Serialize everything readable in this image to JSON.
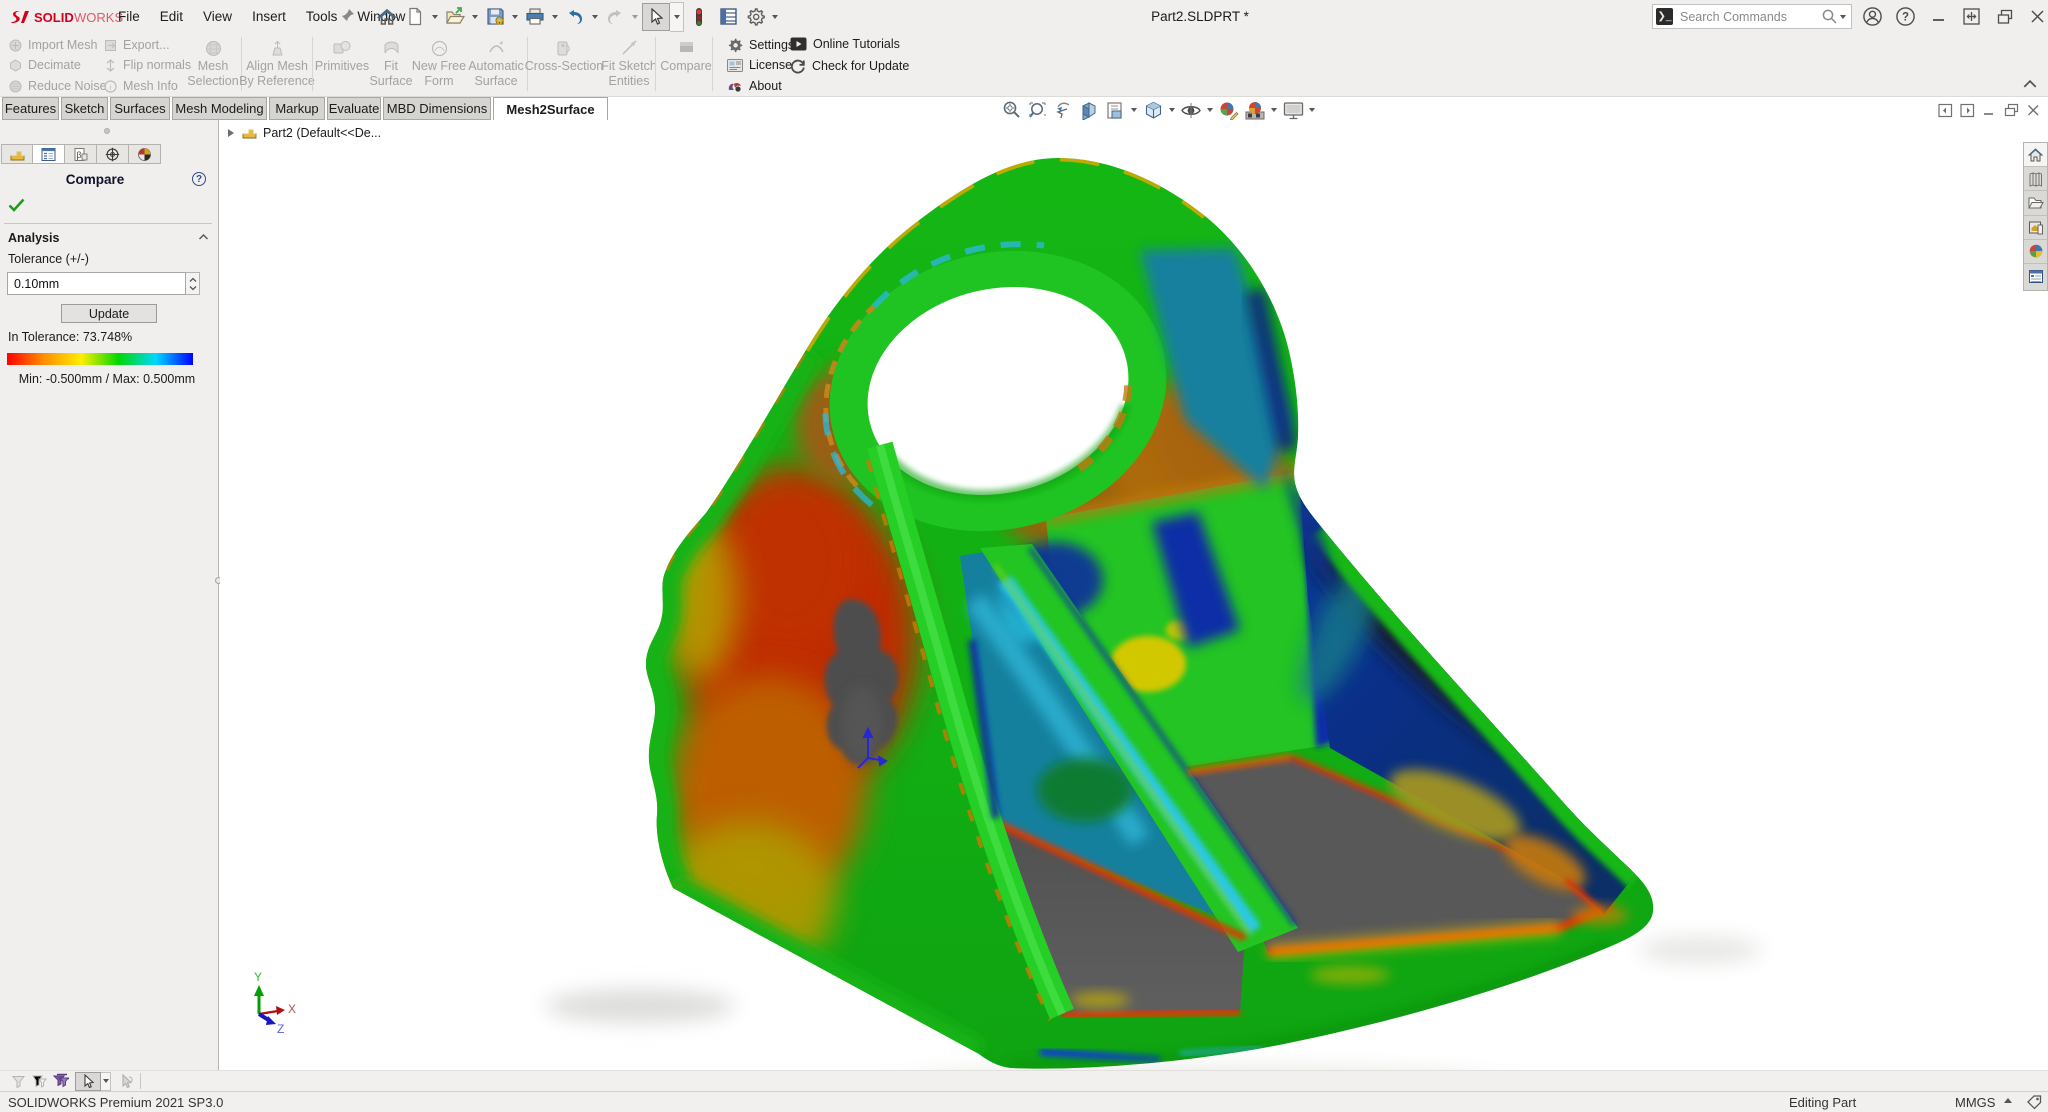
{
  "window": {
    "title": "Part2.SLDPRT *",
    "app_name": "SOLIDWORKS"
  },
  "brand": {
    "solid": "SOLID",
    "works": "WORKS"
  },
  "menubar": {
    "menus": [
      "File",
      "Edit",
      "View",
      "Insert",
      "Tools",
      "Window"
    ]
  },
  "quickbar_icons": [
    "home-icon",
    "new-document-icon",
    "open-icon",
    "save-icon",
    "print-icon",
    "undo-icon",
    "redo-icon",
    "select-cursor-icon",
    "selection-filter-icon",
    "task-table-icon",
    "options-gear-icon"
  ],
  "search": {
    "placeholder": "Search Commands"
  },
  "titlebar_icons": [
    "user-account-icon",
    "help-icon",
    "minimize-icon",
    "expand-icon",
    "restore-icon",
    "close-icon"
  ],
  "ribbon": {
    "small_items": [
      "Import Mesh",
      "Decimate",
      "Reduce Noise",
      "Export...",
      "Flip normals",
      "Mesh Info"
    ],
    "large_items": [
      {
        "line1": "Mesh",
        "line2": "Selection"
      },
      {
        "line1": "Align Mesh",
        "line2": "By Reference"
      },
      {
        "line1": "Primitives",
        "line2": ""
      },
      {
        "line1": "Fit",
        "line2": "Surface"
      },
      {
        "line1": "New Free",
        "line2": "Form"
      },
      {
        "line1": "Automatic",
        "line2": "Surface"
      },
      {
        "line1": "Cross-Section",
        "line2": ""
      },
      {
        "line1": "Fit Sketch",
        "line2": "Entities"
      },
      {
        "line1": "Compare",
        "line2": ""
      }
    ],
    "menu_items": [
      "Settings",
      "License",
      "About",
      "Online Tutorials",
      "Check for Update"
    ]
  },
  "tabs": [
    {
      "label": "Features",
      "active": false
    },
    {
      "label": "Sketch",
      "active": false
    },
    {
      "label": "Surfaces",
      "active": false
    },
    {
      "label": "Mesh Modeling",
      "active": false
    },
    {
      "label": "Markup",
      "active": false
    },
    {
      "label": "Evaluate",
      "active": false
    },
    {
      "label": "MBD Dimensions",
      "active": false
    },
    {
      "label": "Mesh2Surface",
      "active": true
    }
  ],
  "feature_tree": {
    "root": "Part2  (Default<<De..."
  },
  "property_panel": {
    "title": "Compare",
    "tab_icons": [
      "feature-tree-icon",
      "property-manager-icon",
      "configuration-icon",
      "dimxpert-icon",
      "display-manager-icon"
    ],
    "section": "Analysis",
    "tolerance_label": "Tolerance (+/-)",
    "tolerance_value": "0.10mm",
    "update_button": "Update",
    "in_tolerance": "In Tolerance: 73.748%",
    "range_caption": "Min: -0.500mm / Max: 0.500mm",
    "scale_colors": [
      "#ff0000",
      "#ff9000",
      "#ffee00",
      "#00d800",
      "#00d8ff",
      "#0000ff"
    ]
  },
  "viewport": {
    "headsup_icons": [
      "zoom-to-fit-icon",
      "zoom-to-area-icon",
      "previous-view-icon",
      "section-view-icon",
      "3d-drawing-view-icon",
      "view-orientation-icon",
      "display-style-icon",
      "hide-show-items-icon",
      "edit-appearance-icon",
      "apply-scene-icon",
      "view-settings-icon"
    ],
    "triad": {
      "x": "X",
      "y": "Y",
      "z": "Z"
    }
  },
  "task_pane_icons": [
    "solidworks-resources-icon",
    "design-library-icon",
    "file-explorer-icon",
    "view-palette-icon",
    "appearances-icon",
    "custom-properties-icon"
  ],
  "status_bar": {
    "left": "SOLIDWORKS Premium 2021 SP3.0",
    "mode": "Editing Part",
    "units": "MMGS"
  }
}
